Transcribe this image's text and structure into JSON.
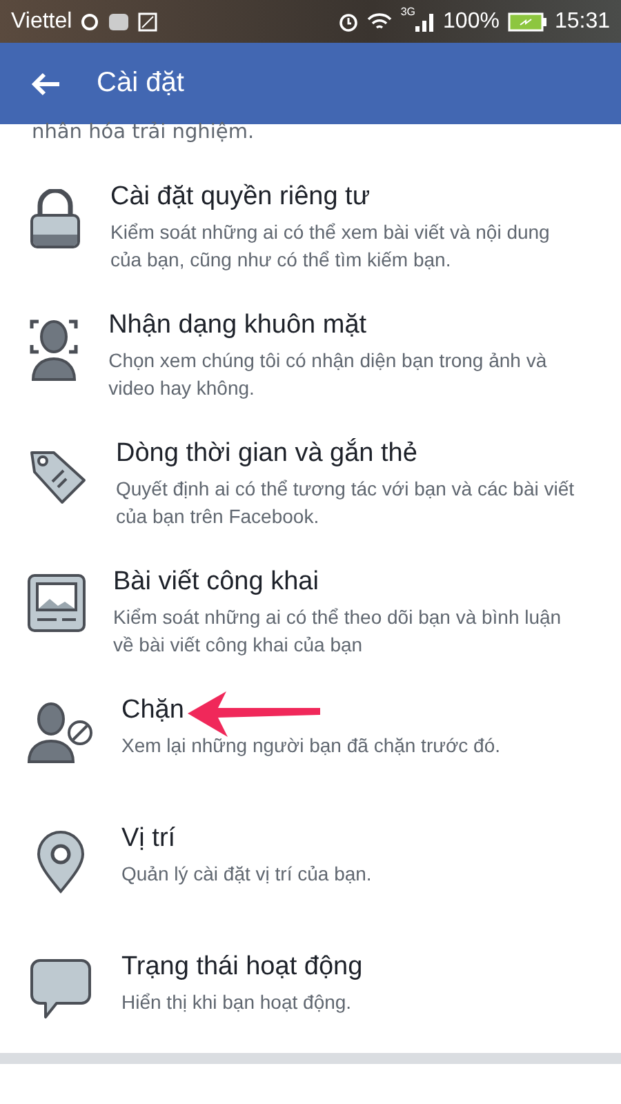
{
  "status_bar": {
    "carrier": "Viettel",
    "network": "3G",
    "battery": "100%",
    "time": "15:31"
  },
  "header": {
    "title": "Cài đặt"
  },
  "intro_tail": "nhân hóa trải nghiệm.",
  "items": [
    {
      "title": "Cài đặt quyền riêng tư",
      "description": "Kiểm soát những ai có thể xem bài viết và nội dung của bạn, cũng như có thể tìm kiếm bạn."
    },
    {
      "title": "Nhận dạng khuôn mặt",
      "description": "Chọn xem chúng tôi có nhận diện bạn trong ảnh và video hay không."
    },
    {
      "title": "Dòng thời gian và gắn thẻ",
      "description": "Quyết định ai có thể tương tác với bạn và các bài viết của bạn trên Facebook."
    },
    {
      "title": "Bài viết công khai",
      "description": "Kiểm soát những ai có thể theo dõi bạn và bình luận về bài viết công khai của bạn"
    },
    {
      "title": "Chặn",
      "description": "Xem lại những người bạn đã chặn trước đó."
    },
    {
      "title": "Vị trí",
      "description": "Quản lý cài đặt vị trí của bạn."
    },
    {
      "title": "Trạng thái hoạt động",
      "description": "Hiển thị khi bạn hoạt động."
    }
  ]
}
